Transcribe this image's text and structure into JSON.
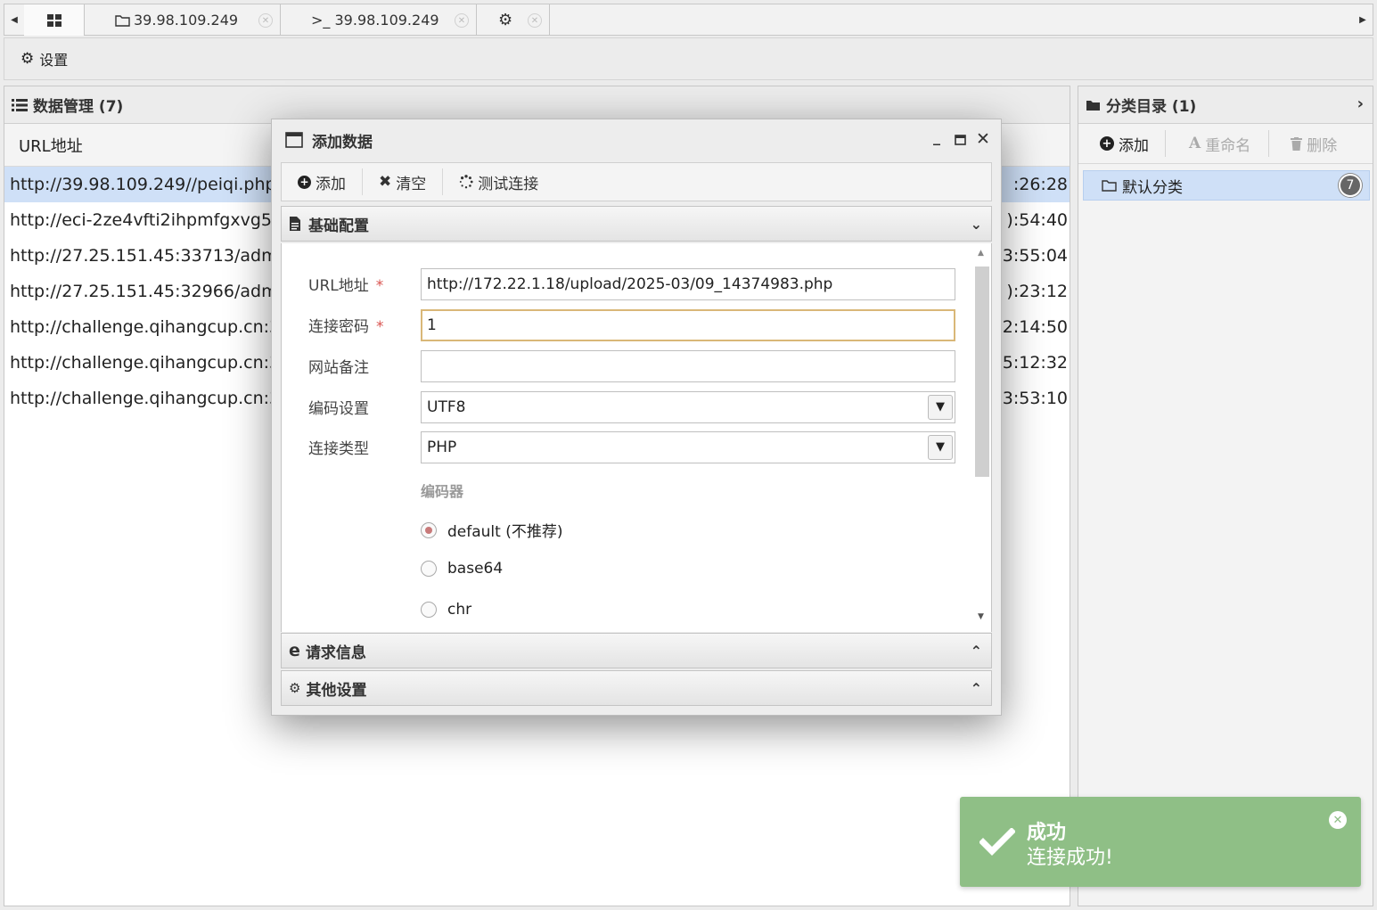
{
  "tabs": [
    {
      "icon": "grid-icon",
      "label": ""
    },
    {
      "icon": "folder-icon",
      "label": "39.98.109.249"
    },
    {
      "icon": "terminal-icon",
      "label": ">_ 39.98.109.249"
    },
    {
      "icon": "gear-icon",
      "label": ""
    }
  ],
  "toolbar": {
    "settings_label": "设置"
  },
  "data_panel": {
    "title": "数据管理 (7)",
    "column_url": "URL地址",
    "rows": [
      {
        "url": "http://39.98.109.249//peiqi.php",
        "time": ":26:28",
        "selected": true
      },
      {
        "url": "http://eci-2ze4vfti2ihpmfgxvg5y.c",
        "time": "):54:40",
        "selected": false
      },
      {
        "url": "http://27.25.151.45:33713/admin",
        "time": "3:55:04",
        "selected": false
      },
      {
        "url": "http://27.25.151.45:32966/admin",
        "time": "):23:12",
        "selected": false
      },
      {
        "url": "http://challenge.qihangcup.cn:353",
        "time": "2:14:50",
        "selected": false
      },
      {
        "url": "http://challenge.qihangcup.cn:340",
        "time": "5:12:32",
        "selected": false
      },
      {
        "url": "http://challenge.qihangcup.cn:334",
        "time": "3:53:10",
        "selected": false
      }
    ]
  },
  "category_panel": {
    "title": "分类目录 (1)",
    "add_label": "添加",
    "rename_label": "重命名",
    "delete_label": "删除",
    "items": [
      {
        "name": "默认分类",
        "count": "7"
      }
    ]
  },
  "dialog": {
    "title": "添加数据",
    "toolbar": {
      "add_label": "添加",
      "clear_label": "清空",
      "test_label": "测试连接"
    },
    "section_basic": "基础配置",
    "section_request": "请求信息",
    "section_other": "其他设置",
    "form": {
      "url_label": "URL地址",
      "url_value": "http://172.22.1.18/upload/2025-03/09_14374983.php",
      "password_label": "连接密码",
      "password_value": "1",
      "note_label": "网站备注",
      "note_value": "",
      "encoding_label": "编码设置",
      "encoding_value": "UTF8",
      "type_label": "连接类型",
      "type_value": "PHP",
      "encoder_label": "编码器",
      "required_mark": "*",
      "encoders": [
        {
          "label": "default (不推荐)",
          "checked": true
        },
        {
          "label": "base64",
          "checked": false
        },
        {
          "label": "chr",
          "checked": false
        }
      ]
    }
  },
  "toast": {
    "title": "成功",
    "message": "连接成功!",
    "color": "#8fbf86"
  }
}
